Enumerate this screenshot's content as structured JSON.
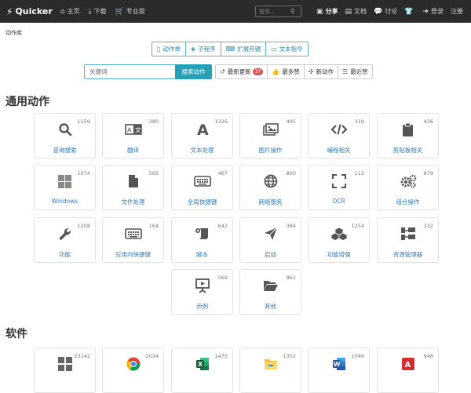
{
  "navbar": {
    "brand": "Quicker",
    "left_items": [
      {
        "label": "主页",
        "icon": "home-icon"
      },
      {
        "label": "下载",
        "icon": "download-icon"
      },
      {
        "label": "专业版",
        "icon": "cart-icon"
      }
    ],
    "search_placeholder": "搜索...",
    "right_items": [
      {
        "label": "分享",
        "icon": "share-icon"
      },
      {
        "label": "文档",
        "icon": "doc-icon"
      },
      {
        "label": "讨论",
        "icon": "comments-icon"
      },
      {
        "label": "",
        "icon": "shirt-icon"
      },
      {
        "label": "登录",
        "icon": "login-icon"
      },
      {
        "label": "注册",
        "icon": ""
      }
    ]
  },
  "breadcrumb": "动作库",
  "tabs": [
    {
      "label": "动作单",
      "icon": "book-icon"
    },
    {
      "label": "子程序",
      "icon": "cube-icon"
    },
    {
      "label": "扩展热键",
      "icon": "keyboard-icon"
    },
    {
      "label": "文本指令",
      "icon": "terminal-icon"
    }
  ],
  "search": {
    "placeholder": "关键词",
    "button": "搜索动作"
  },
  "sort_buttons": [
    {
      "label": "最新更新",
      "icon": "history-icon",
      "badge": "37"
    },
    {
      "label": "最多赞",
      "icon": "thumbs-up-icon",
      "badge": ""
    },
    {
      "label": "新动作",
      "icon": "new-icon",
      "badge": ""
    },
    {
      "label": "最近赞",
      "icon": "list-icon",
      "badge": ""
    }
  ],
  "sections": {
    "general_title": "通用动作",
    "software_title": "软件"
  },
  "general_actions": [
    {
      "label": "查询搜索",
      "count": "1159",
      "icon": "search-icon"
    },
    {
      "label": "翻译",
      "count": "280",
      "icon": "translate-icon"
    },
    {
      "label": "文本处理",
      "count": "1326",
      "icon": "font-icon"
    },
    {
      "label": "图片操作",
      "count": "495",
      "icon": "images-icon"
    },
    {
      "label": "编程相关",
      "count": "319",
      "icon": "code-icon"
    },
    {
      "label": "剪贴板相关",
      "count": "436",
      "icon": "clipboard-icon"
    },
    {
      "label": "Windows",
      "count": "1074",
      "icon": "windows-icon"
    },
    {
      "label": "文件处理",
      "count": "565",
      "icon": "file-icon"
    },
    {
      "label": "全局快捷键",
      "count": "467",
      "icon": "keyboard-icon"
    },
    {
      "label": "网络服务",
      "count": "800",
      "icon": "globe-icon"
    },
    {
      "label": "OCR",
      "count": "112",
      "icon": "ocr-icon"
    },
    {
      "label": "组合操作",
      "count": "879",
      "icon": "cogs-icon"
    },
    {
      "label": "功能",
      "count": "1208",
      "icon": "wrench-icon"
    },
    {
      "label": "应用内快捷键",
      "count": "164",
      "icon": "keyboard-icon"
    },
    {
      "label": "脚本",
      "count": "642",
      "icon": "scroll-icon"
    },
    {
      "label": "启动",
      "count": "384",
      "icon": "paper-plane-icon"
    },
    {
      "label": "功能增强",
      "count": "1254",
      "icon": "cubes-icon"
    },
    {
      "label": "资源管理器",
      "count": "332",
      "icon": "sitemap-icon"
    },
    {
      "label": "示例",
      "count": "569",
      "icon": "presentation-icon"
    },
    {
      "label": "其他",
      "count": "861",
      "icon": "folder-open-icon"
    }
  ],
  "software": [
    {
      "count": "23142",
      "icon": "windows-grid-icon"
    },
    {
      "count": "2034",
      "icon": "chrome-icon"
    },
    {
      "count": "1475",
      "icon": "excel-icon"
    },
    {
      "count": "1352",
      "icon": "file-explorer-icon"
    },
    {
      "count": "1046",
      "icon": "word-icon"
    },
    {
      "count": "948",
      "icon": "acrobat-icon"
    }
  ],
  "colors": {
    "navbar_bg": "#2b2b2b",
    "accent": "#26a0b9",
    "link": "#337ab7",
    "badge": "#d9534f",
    "excel": "#1d6f42",
    "word": "#2b579a",
    "acrobat": "#d32f2f"
  }
}
